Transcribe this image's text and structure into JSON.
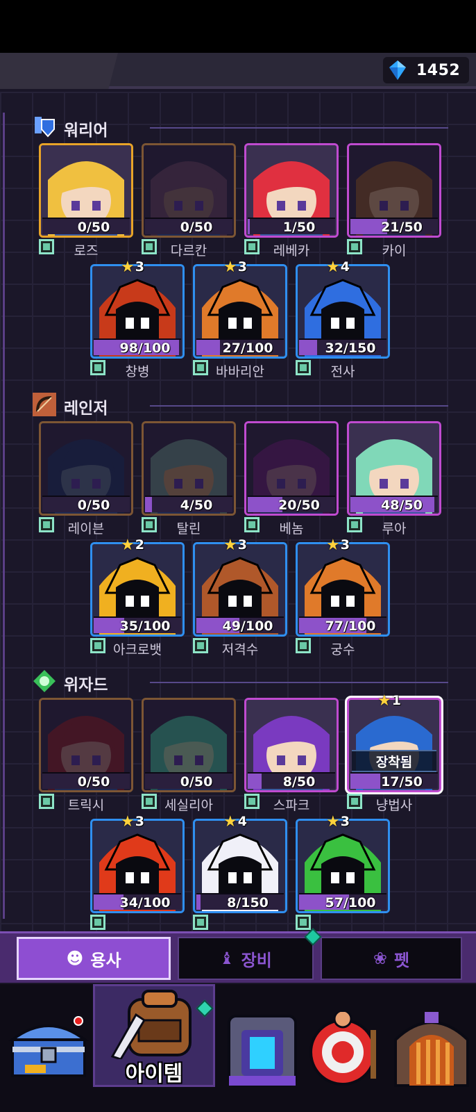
{
  "currency": {
    "icon": "blue-gem-icon",
    "amount": "1452"
  },
  "sections": [
    {
      "title": "워리어",
      "icon": "sword-shield-icon",
      "row1": [
        {
          "name": "로즈",
          "progress": "0/50",
          "frame": "gold",
          "fill": 0,
          "color": "#f0c040",
          "skin": "#f3d7bf"
        },
        {
          "name": "다르칸",
          "progress": "0/50",
          "frame": "brownf",
          "fill": 0,
          "dim": true,
          "color": "#6a4a6a",
          "skin": "#8a6a6a"
        },
        {
          "name": "레베카",
          "progress": "1/50",
          "frame": "pink",
          "fill": 0.02,
          "color": "#e03040",
          "skin": "#f3d7bf"
        },
        {
          "name": "카이",
          "progress": "21/50",
          "frame": "pink",
          "fill": 0.42,
          "dim": true,
          "color": "#8a5a3a",
          "skin": "#c49a7a"
        }
      ],
      "row2": [
        {
          "name": "창병",
          "progress": "98/100",
          "frame": "blue",
          "fill": 0.98,
          "stars": "3",
          "color": "#c83a1a"
        },
        {
          "name": "바바리안",
          "progress": "27/100",
          "frame": "blue",
          "fill": 0.27,
          "stars": "3",
          "color": "#e07a2a"
        },
        {
          "name": "전사",
          "progress": "32/150",
          "frame": "blue",
          "fill": 0.21,
          "stars": "4",
          "color": "#2f6ee0"
        }
      ]
    },
    {
      "title": "레인저",
      "icon": "bow-icon",
      "row1": [
        {
          "name": "레이븐",
          "progress": "0/50",
          "frame": "brownf",
          "fill": 0,
          "dim": true,
          "color": "#2a3a6a",
          "skin": "#5a6a8a"
        },
        {
          "name": "탈린",
          "progress": "4/50",
          "frame": "brownf",
          "fill": 0.08,
          "dim": true,
          "color": "#6a8a8a",
          "skin": "#b08a6a"
        },
        {
          "name": "베놈",
          "progress": "20/50",
          "frame": "pink",
          "fill": 0.4,
          "dim": true,
          "color": "#6a2a7a",
          "skin": "#9a6a8a"
        },
        {
          "name": "루아",
          "progress": "48/50",
          "frame": "pink",
          "fill": 0.96,
          "color": "#80d8b8",
          "skin": "#f3d7bf"
        }
      ],
      "row2": [
        {
          "name": "아크로뱃",
          "progress": "35/100",
          "frame": "blue",
          "fill": 0.35,
          "stars": "2",
          "color": "#f0b020"
        },
        {
          "name": "저격수",
          "progress": "49/100",
          "frame": "blue",
          "fill": 0.49,
          "stars": "3",
          "color": "#b0582a"
        },
        {
          "name": "궁수",
          "progress": "77/100",
          "frame": "blue",
          "fill": 0.77,
          "stars": "3",
          "color": "#e07a2a"
        }
      ]
    },
    {
      "title": "위자드",
      "icon": "magic-rune-icon",
      "row1": [
        {
          "name": "트릭시",
          "progress": "0/50",
          "frame": "brownf",
          "fill": 0,
          "dim": true,
          "color": "#8a2a3a",
          "skin": "#b07a7a"
        },
        {
          "name": "세실리아",
          "progress": "0/50",
          "frame": "brownf",
          "fill": 0,
          "dim": true,
          "color": "#4ab09a",
          "skin": "#9ac0a0"
        },
        {
          "name": "스파크",
          "progress": "8/50",
          "frame": "pink",
          "fill": 0.16,
          "color": "#7a3ac0",
          "skin": "#f3d7bf"
        },
        {
          "name": "냥법사",
          "progress": "17/50",
          "frame": "pink",
          "fill": 0.34,
          "stars": "1",
          "equipped": "장착됨",
          "selected": true,
          "color": "#2a6ad0",
          "skin": "#f3d7bf"
        }
      ],
      "row2": [
        {
          "name": "",
          "progress": "34/100",
          "frame": "blue",
          "fill": 0.34,
          "stars": "3",
          "color": "#e03a1a"
        },
        {
          "name": "",
          "progress": "8/150",
          "frame": "blue",
          "fill": 0.05,
          "stars": "4",
          "color": "#f0f0f8"
        },
        {
          "name": "",
          "progress": "57/100",
          "frame": "blue",
          "fill": 0.57,
          "stars": "3",
          "color": "#3ac040"
        }
      ]
    }
  ],
  "tabs": [
    {
      "label": "용사",
      "icon": "hero-icon",
      "active": true
    },
    {
      "label": "장비",
      "icon": "armor-icon",
      "active": false
    },
    {
      "label": "펫",
      "icon": "paw-icon",
      "active": false
    }
  ],
  "bottom_nav": {
    "active_label": "아이템",
    "items": [
      "treasure-chest-icon",
      "backpack-icon",
      "portal-icon",
      "target-icon",
      "dungeon-door-icon"
    ]
  }
}
